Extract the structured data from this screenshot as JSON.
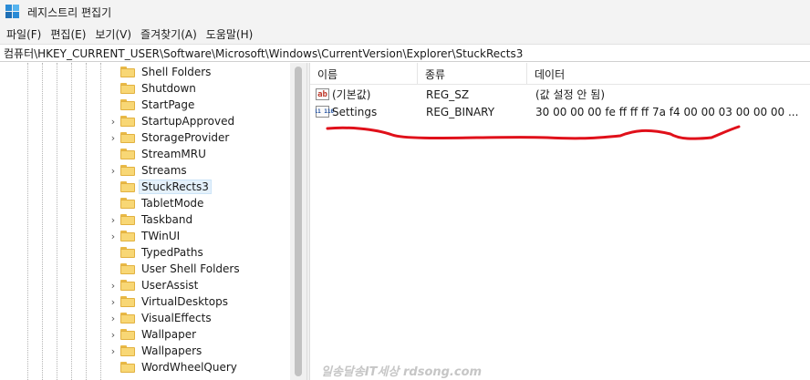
{
  "window": {
    "title": "레지스트리 편집기"
  },
  "menu": [
    "파일(F)",
    "편집(E)",
    "보기(V)",
    "즐겨찾기(A)",
    "도움말(H)"
  ],
  "address": "컴퓨터\\HKEY_CURRENT_USER\\Software\\Microsoft\\Windows\\CurrentVersion\\Explorer\\StuckRects3",
  "tree": {
    "items": [
      {
        "label": "Shell Folders",
        "expandable": false,
        "selected": false
      },
      {
        "label": "Shutdown",
        "expandable": false,
        "selected": false
      },
      {
        "label": "StartPage",
        "expandable": false,
        "selected": false
      },
      {
        "label": "StartupApproved",
        "expandable": true,
        "selected": false
      },
      {
        "label": "StorageProvider",
        "expandable": true,
        "selected": false
      },
      {
        "label": "StreamMRU",
        "expandable": false,
        "selected": false
      },
      {
        "label": "Streams",
        "expandable": true,
        "selected": false
      },
      {
        "label": "StuckRects3",
        "expandable": false,
        "selected": true
      },
      {
        "label": "TabletMode",
        "expandable": false,
        "selected": false
      },
      {
        "label": "Taskband",
        "expandable": true,
        "selected": false
      },
      {
        "label": "TWinUI",
        "expandable": true,
        "selected": false
      },
      {
        "label": "TypedPaths",
        "expandable": false,
        "selected": false
      },
      {
        "label": "User Shell Folders",
        "expandable": false,
        "selected": false
      },
      {
        "label": "UserAssist",
        "expandable": true,
        "selected": false
      },
      {
        "label": "VirtualDesktops",
        "expandable": true,
        "selected": false
      },
      {
        "label": "VisualEffects",
        "expandable": true,
        "selected": false
      },
      {
        "label": "Wallpaper",
        "expandable": true,
        "selected": false
      },
      {
        "label": "Wallpapers",
        "expandable": true,
        "selected": false
      },
      {
        "label": "WordWheelQuery",
        "expandable": false,
        "selected": false
      }
    ]
  },
  "list": {
    "columns": [
      "이름",
      "종류",
      "데이터"
    ],
    "rows": [
      {
        "icon": "string-value-icon",
        "icon_text": "ab",
        "name": "(기본값)",
        "type": "REG_SZ",
        "data": "(값 설정 안 됨)"
      },
      {
        "icon": "binary-value-icon",
        "icon_text": "011 110",
        "name": "Settings",
        "type": "REG_BINARY",
        "data": "30 00 00 00 fe ff ff ff 7a f4 00 00 03 00 00 00 ..."
      }
    ]
  },
  "annotation_color": "#e0101a",
  "watermark": "일송달송IT세상 rdsong.com"
}
